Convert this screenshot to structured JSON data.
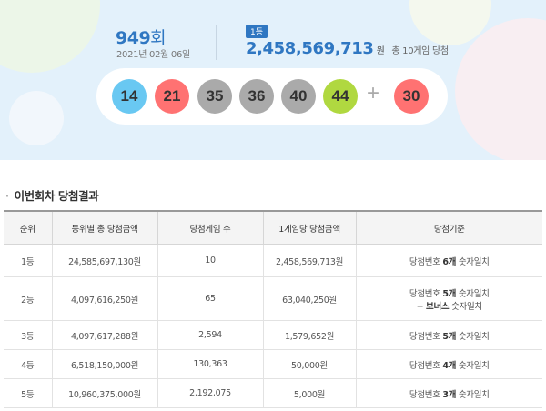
{
  "draw": {
    "round_number": "949",
    "round_unit": "회",
    "date": "2021년 02월 06일",
    "first_prize": {
      "rank_badge": "1등",
      "amount": "2,458,569,713",
      "amount_unit": "원",
      "winners_text": "총 10게임 당첨"
    },
    "numbers": [
      {
        "value": "14",
        "color": "#69c8f2"
      },
      {
        "value": "21",
        "color": "#ff7272"
      },
      {
        "value": "35",
        "color": "#aaaaaa"
      },
      {
        "value": "36",
        "color": "#aaaaaa"
      },
      {
        "value": "40",
        "color": "#aaaaaa"
      },
      {
        "value": "44",
        "color": "#b0d840"
      }
    ],
    "plus_symbol": "+",
    "bonus": {
      "value": "30",
      "color": "#ff7272"
    }
  },
  "results": {
    "section_bullet": "·",
    "section_title": "이번회차 당첨결과",
    "headers": [
      "순위",
      "등위별 총 당첨금액",
      "당첨게임 수",
      "1게임당 당첨금액",
      "당첨기준"
    ],
    "rows": [
      {
        "rank": "1등",
        "total": "24,585,697,130원",
        "games": "10",
        "per_game": "2,458,569,713원",
        "criteria_prefix": "당첨번호 ",
        "criteria_count": "6개",
        "criteria_suffix": " 숫자일치",
        "criteria_bonus_pre": "",
        "criteria_bonus": "",
        "criteria_bonus_post": ""
      },
      {
        "rank": "2등",
        "total": "4,097,616,250원",
        "games": "65",
        "per_game": "63,040,250원",
        "criteria_prefix": "당첨번호 ",
        "criteria_count": "5개",
        "criteria_suffix": " 숫자일치",
        "criteria_bonus_pre": "+ ",
        "criteria_bonus": "보너스",
        "criteria_bonus_post": " 숫자일치"
      },
      {
        "rank": "3등",
        "total": "4,097,617,288원",
        "games": "2,594",
        "per_game": "1,579,652원",
        "criteria_prefix": "당첨번호 ",
        "criteria_count": "5개",
        "criteria_suffix": " 숫자일치",
        "criteria_bonus_pre": "",
        "criteria_bonus": "",
        "criteria_bonus_post": ""
      },
      {
        "rank": "4등",
        "total": "6,518,150,000원",
        "games": "130,363",
        "per_game": "50,000원",
        "criteria_prefix": "당첨번호 ",
        "criteria_count": "4개",
        "criteria_suffix": " 숫자일치",
        "criteria_bonus_pre": "",
        "criteria_bonus": "",
        "criteria_bonus_post": ""
      },
      {
        "rank": "5등",
        "total": "10,960,375,000원",
        "games": "2,192,075",
        "per_game": "5,000원",
        "criteria_prefix": "당첨번호 ",
        "criteria_count": "3개",
        "criteria_suffix": " 숫자일치",
        "criteria_bonus_pre": "",
        "criteria_bonus": "",
        "criteria_bonus_post": ""
      }
    ]
  }
}
